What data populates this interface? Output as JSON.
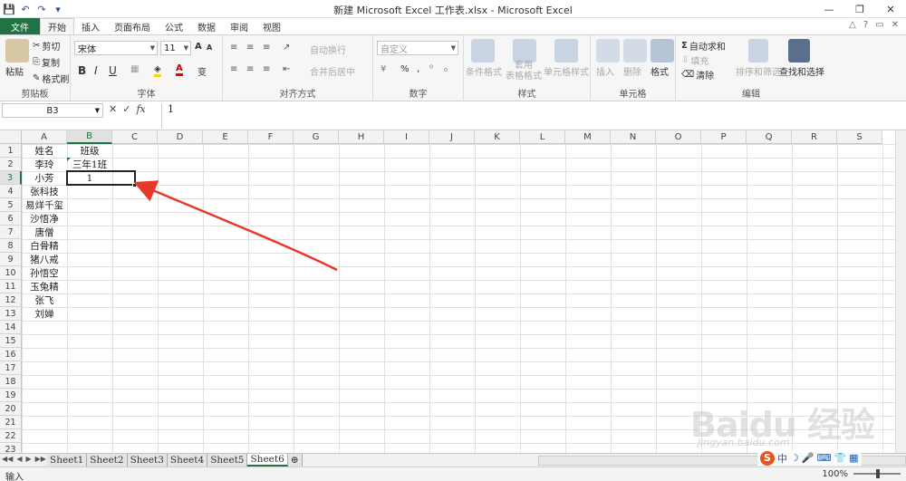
{
  "window": {
    "title": "新建 Microsoft Excel 工作表.xlsx - Microsoft Excel",
    "minimize": "—",
    "restore": "❐",
    "close": "✕"
  },
  "qat": {
    "save": "💾",
    "undo": "↶",
    "redo": "↷",
    "customize": "▾"
  },
  "tabs": [
    "文件",
    "开始",
    "插入",
    "页面布局",
    "公式",
    "数据",
    "审阅",
    "视图"
  ],
  "active_tab": "开始",
  "ribbon_right": [
    "△",
    "?",
    "▭",
    "✕"
  ],
  "ribbon": {
    "clipboard": {
      "paste": "粘贴",
      "cut": "剪切",
      "copy": "复制",
      "format_painter": "格式刷",
      "label": "剪贴板"
    },
    "font": {
      "name": "宋体",
      "size": "11",
      "grow": "A",
      "shrink": "A",
      "bold": "B",
      "italic": "I",
      "underline": "U",
      "label": "字体",
      "wen": "变"
    },
    "alignment": {
      "wrap": "自动换行",
      "merge": "合并后居中",
      "label": "对齐方式"
    },
    "number": {
      "format": "自定义",
      "percent": "%",
      "comma": ",",
      "label": "数字"
    },
    "styles": {
      "conditional": "条件格式",
      "table": "套用\n表格格式",
      "cell_styles": "单元格样式",
      "label": "样式"
    },
    "cells": {
      "insert": "插入",
      "delete": "删除",
      "format": "格式",
      "label": "单元格"
    },
    "editing": {
      "autosum": "自动求和",
      "fill": "填充",
      "clear": "清除",
      "sort": "排序和筛选",
      "find": "查找和选择",
      "label": "编辑"
    }
  },
  "formula_bar": {
    "name_box": "B3",
    "cancel": "✕",
    "enter": "✓",
    "fx": "fx",
    "content": "1"
  },
  "columns": [
    "A",
    "B",
    "C",
    "D",
    "E",
    "F",
    "G",
    "H",
    "I",
    "J",
    "K",
    "L",
    "M",
    "N",
    "O",
    "P",
    "Q",
    "R",
    "S"
  ],
  "selected_column": "B",
  "rows": [
    "1",
    "2",
    "3",
    "4",
    "5",
    "6",
    "7",
    "8",
    "9",
    "10",
    "11",
    "12",
    "13",
    "14",
    "15",
    "16",
    "17",
    "18",
    "19",
    "20",
    "21",
    "22",
    "23"
  ],
  "selected_row": "3",
  "cells": {
    "A": [
      "姓名",
      "李玲",
      "小芳",
      "张科技",
      "易烊千玺",
      "沙悟净",
      "唐僧",
      "白骨精",
      "猪八戒",
      "孙悟空",
      "玉兔精",
      "张飞",
      "刘婵"
    ],
    "B": [
      "班级",
      "三年1班",
      "1"
    ]
  },
  "sheets": [
    "Sheet1",
    "Sheet2",
    "Sheet3",
    "Sheet4",
    "Sheet5",
    "Sheet6"
  ],
  "active_sheet": "Sheet6",
  "status": {
    "mode": "输入",
    "zoom": "100%"
  },
  "watermark": {
    "brand": "Baidu 经验",
    "url": "jingyan.baidu.com"
  },
  "ime": {
    "logo": "S",
    "lang": "中"
  },
  "colors": {
    "accent": "#217346",
    "arrow": "#e8372b"
  }
}
